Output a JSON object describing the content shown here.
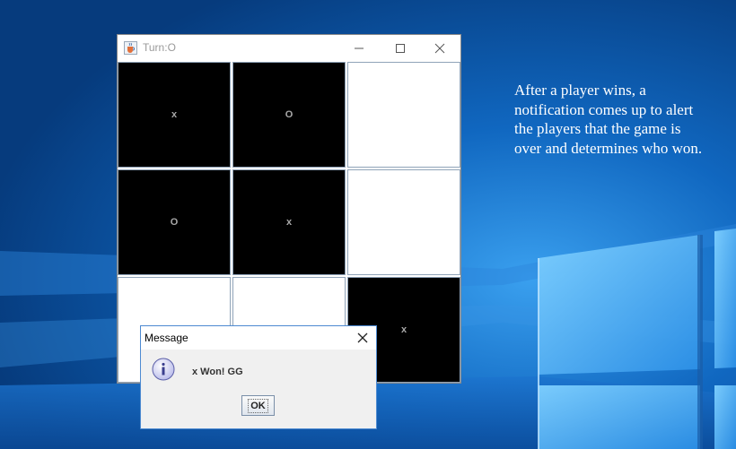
{
  "desktop": {
    "caption": "After a player wins, a notification comes up to alert the players that the game is over and determines who won."
  },
  "window": {
    "title": "Turn:O",
    "icon": "java-cup-icon",
    "controls": [
      "minimize-icon",
      "maximize-icon",
      "close-icon"
    ]
  },
  "board": {
    "cells": [
      {
        "mark": "x",
        "shade": "dark"
      },
      {
        "mark": "O",
        "shade": "dark"
      },
      {
        "mark": "",
        "shade": "light"
      },
      {
        "mark": "O",
        "shade": "dark"
      },
      {
        "mark": "x",
        "shade": "dark"
      },
      {
        "mark": "",
        "shade": "light"
      },
      {
        "mark": "",
        "shade": "light"
      },
      {
        "mark": "",
        "shade": "light"
      },
      {
        "mark": "x",
        "shade": "dark"
      }
    ]
  },
  "dialog": {
    "title": "Message",
    "icon": "info-icon",
    "message": "x Won! GG",
    "ok_label": "OK"
  },
  "colors": {
    "desktop_blue": "#0a4f9c",
    "cell_dark": "#000000",
    "cell_light": "#ffffff",
    "mark_color": "#a8a8a8",
    "dialog_border": "#4d8ad1"
  }
}
